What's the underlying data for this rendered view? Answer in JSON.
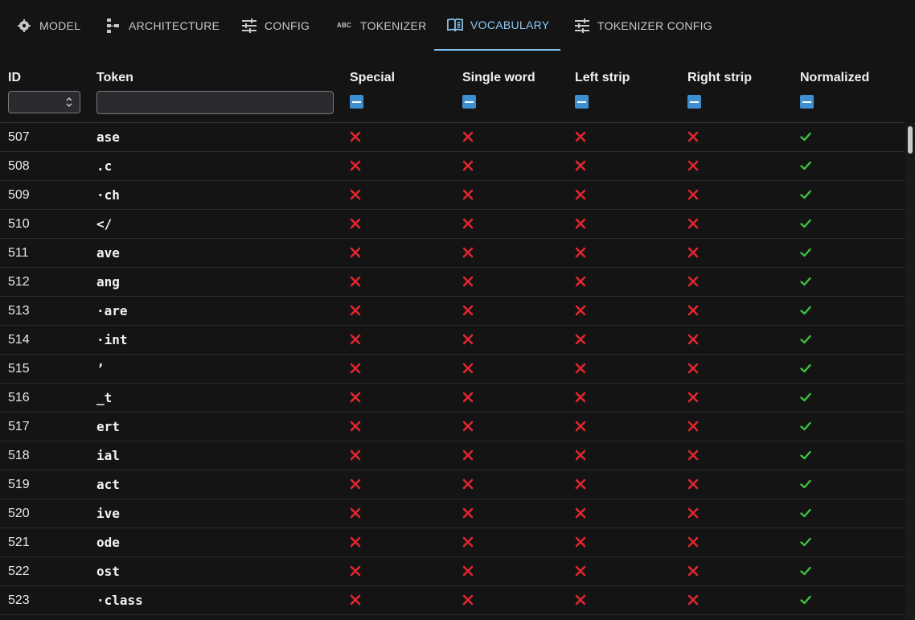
{
  "tabs": [
    {
      "label": "MODEL",
      "icon": "model-icon",
      "active": false
    },
    {
      "label": "ARCHITECTURE",
      "icon": "architecture-icon",
      "active": false
    },
    {
      "label": "CONFIG",
      "icon": "sliders-icon",
      "active": false
    },
    {
      "label": "TOKENIZER",
      "icon": "abc-icon",
      "active": false
    },
    {
      "label": "VOCABULARY",
      "icon": "book-icon",
      "active": true
    },
    {
      "label": "TOKENIZER CONFIG",
      "icon": "sliders-icon",
      "active": false
    }
  ],
  "columns": {
    "id": "ID",
    "token": "Token",
    "special": "Special",
    "single_word": "Single word",
    "left_strip": "Left strip",
    "right_strip": "Right strip",
    "normalized": "Normalized"
  },
  "filters": {
    "id_value": "",
    "token_value": "",
    "special": "indeterminate",
    "single_word": "indeterminate",
    "left_strip": "indeterminate",
    "right_strip": "indeterminate",
    "normalized": "indeterminate"
  },
  "colors": {
    "accent": "#8ec8f2",
    "cross": "#e0262e",
    "check": "#3cc43c",
    "checkbox": "#3f8ed0"
  },
  "rows": [
    {
      "id": "507",
      "token": "ase",
      "special": false,
      "single_word": false,
      "left_strip": false,
      "right_strip": false,
      "normalized": true
    },
    {
      "id": "508",
      "token": ".c",
      "special": false,
      "single_word": false,
      "left_strip": false,
      "right_strip": false,
      "normalized": true
    },
    {
      "id": "509",
      "token": "·ch",
      "special": false,
      "single_word": false,
      "left_strip": false,
      "right_strip": false,
      "normalized": true
    },
    {
      "id": "510",
      "token": "</",
      "special": false,
      "single_word": false,
      "left_strip": false,
      "right_strip": false,
      "normalized": true
    },
    {
      "id": "511",
      "token": "ave",
      "special": false,
      "single_word": false,
      "left_strip": false,
      "right_strip": false,
      "normalized": true
    },
    {
      "id": "512",
      "token": "ang",
      "special": false,
      "single_word": false,
      "left_strip": false,
      "right_strip": false,
      "normalized": true
    },
    {
      "id": "513",
      "token": "·are",
      "special": false,
      "single_word": false,
      "left_strip": false,
      "right_strip": false,
      "normalized": true
    },
    {
      "id": "514",
      "token": "·int",
      "special": false,
      "single_word": false,
      "left_strip": false,
      "right_strip": false,
      "normalized": true
    },
    {
      "id": "515",
      "token": "’",
      "special": false,
      "single_word": false,
      "left_strip": false,
      "right_strip": false,
      "normalized": true
    },
    {
      "id": "516",
      "token": "_t",
      "special": false,
      "single_word": false,
      "left_strip": false,
      "right_strip": false,
      "normalized": true
    },
    {
      "id": "517",
      "token": "ert",
      "special": false,
      "single_word": false,
      "left_strip": false,
      "right_strip": false,
      "normalized": true
    },
    {
      "id": "518",
      "token": "ial",
      "special": false,
      "single_word": false,
      "left_strip": false,
      "right_strip": false,
      "normalized": true
    },
    {
      "id": "519",
      "token": "act",
      "special": false,
      "single_word": false,
      "left_strip": false,
      "right_strip": false,
      "normalized": true
    },
    {
      "id": "520",
      "token": "ive",
      "special": false,
      "single_word": false,
      "left_strip": false,
      "right_strip": false,
      "normalized": true
    },
    {
      "id": "521",
      "token": "ode",
      "special": false,
      "single_word": false,
      "left_strip": false,
      "right_strip": false,
      "normalized": true
    },
    {
      "id": "522",
      "token": "ost",
      "special": false,
      "single_word": false,
      "left_strip": false,
      "right_strip": false,
      "normalized": true
    },
    {
      "id": "523",
      "token": "·class",
      "special": false,
      "single_word": false,
      "left_strip": false,
      "right_strip": false,
      "normalized": true
    }
  ]
}
